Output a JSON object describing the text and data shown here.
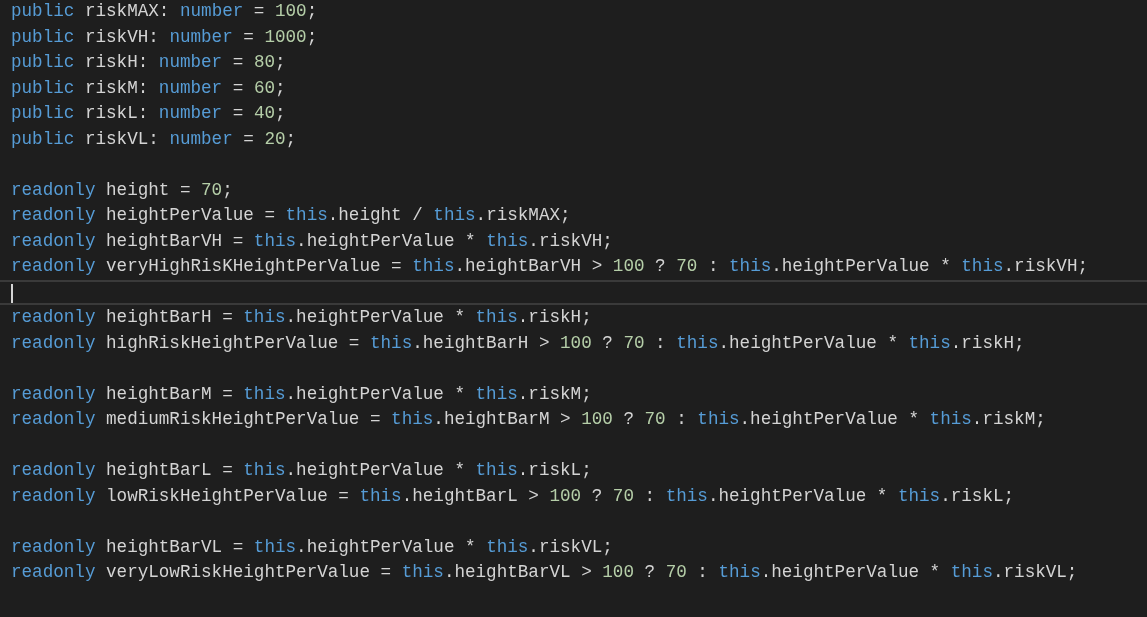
{
  "editor": {
    "lines": [
      {
        "kind": "code",
        "tokens": [
          {
            "kind": "keyword",
            "text": "public"
          },
          {
            "kind": "plain",
            "text": " riskMAX: "
          },
          {
            "kind": "type",
            "text": "number"
          },
          {
            "kind": "plain",
            "text": " = "
          },
          {
            "kind": "number",
            "text": "100"
          },
          {
            "kind": "plain",
            "text": ";"
          }
        ]
      },
      {
        "kind": "code",
        "tokens": [
          {
            "kind": "keyword",
            "text": "public"
          },
          {
            "kind": "plain",
            "text": " riskVH: "
          },
          {
            "kind": "type",
            "text": "number"
          },
          {
            "kind": "plain",
            "text": " = "
          },
          {
            "kind": "number",
            "text": "1000"
          },
          {
            "kind": "plain",
            "text": ";"
          }
        ]
      },
      {
        "kind": "code",
        "tokens": [
          {
            "kind": "keyword",
            "text": "public"
          },
          {
            "kind": "plain",
            "text": " riskH: "
          },
          {
            "kind": "type",
            "text": "number"
          },
          {
            "kind": "plain",
            "text": " = "
          },
          {
            "kind": "number",
            "text": "80"
          },
          {
            "kind": "plain",
            "text": ";"
          }
        ]
      },
      {
        "kind": "code",
        "tokens": [
          {
            "kind": "keyword",
            "text": "public"
          },
          {
            "kind": "plain",
            "text": " riskM: "
          },
          {
            "kind": "type",
            "text": "number"
          },
          {
            "kind": "plain",
            "text": " = "
          },
          {
            "kind": "number",
            "text": "60"
          },
          {
            "kind": "plain",
            "text": ";"
          }
        ]
      },
      {
        "kind": "code",
        "tokens": [
          {
            "kind": "keyword",
            "text": "public"
          },
          {
            "kind": "plain",
            "text": " riskL: "
          },
          {
            "kind": "type",
            "text": "number"
          },
          {
            "kind": "plain",
            "text": " = "
          },
          {
            "kind": "number",
            "text": "40"
          },
          {
            "kind": "plain",
            "text": ";"
          }
        ]
      },
      {
        "kind": "code",
        "tokens": [
          {
            "kind": "keyword",
            "text": "public"
          },
          {
            "kind": "plain",
            "text": " riskVL: "
          },
          {
            "kind": "type",
            "text": "number"
          },
          {
            "kind": "plain",
            "text": " = "
          },
          {
            "kind": "number",
            "text": "20"
          },
          {
            "kind": "plain",
            "text": ";"
          }
        ]
      },
      {
        "kind": "blank"
      },
      {
        "kind": "code",
        "tokens": [
          {
            "kind": "keyword",
            "text": "readonly"
          },
          {
            "kind": "plain",
            "text": " height = "
          },
          {
            "kind": "number",
            "text": "70"
          },
          {
            "kind": "plain",
            "text": ";"
          }
        ]
      },
      {
        "kind": "code",
        "tokens": [
          {
            "kind": "keyword",
            "text": "readonly"
          },
          {
            "kind": "plain",
            "text": " heightPerValue = "
          },
          {
            "kind": "keyword",
            "text": "this"
          },
          {
            "kind": "plain",
            "text": ".height / "
          },
          {
            "kind": "keyword",
            "text": "this"
          },
          {
            "kind": "plain",
            "text": ".riskMAX;"
          }
        ]
      },
      {
        "kind": "code",
        "tokens": [
          {
            "kind": "keyword",
            "text": "readonly"
          },
          {
            "kind": "plain",
            "text": " heightBarVH = "
          },
          {
            "kind": "keyword",
            "text": "this"
          },
          {
            "kind": "plain",
            "text": ".heightPerValue * "
          },
          {
            "kind": "keyword",
            "text": "this"
          },
          {
            "kind": "plain",
            "text": ".riskVH;"
          }
        ]
      },
      {
        "kind": "code",
        "tokens": [
          {
            "kind": "keyword",
            "text": "readonly"
          },
          {
            "kind": "plain",
            "text": " veryHighRisKHeightPerValue = "
          },
          {
            "kind": "keyword",
            "text": "this"
          },
          {
            "kind": "plain",
            "text": ".heightBarVH > "
          },
          {
            "kind": "number",
            "text": "100"
          },
          {
            "kind": "plain",
            "text": " ? "
          },
          {
            "kind": "number",
            "text": "70"
          },
          {
            "kind": "plain",
            "text": " : "
          },
          {
            "kind": "keyword",
            "text": "this"
          },
          {
            "kind": "plain",
            "text": ".heightPerValue * "
          },
          {
            "kind": "keyword",
            "text": "this"
          },
          {
            "kind": "plain",
            "text": ".riskVH;"
          }
        ]
      },
      {
        "kind": "cursor"
      },
      {
        "kind": "code",
        "tokens": [
          {
            "kind": "keyword",
            "text": "readonly"
          },
          {
            "kind": "plain",
            "text": " heightBarH = "
          },
          {
            "kind": "keyword",
            "text": "this"
          },
          {
            "kind": "plain",
            "text": ".heightPerValue * "
          },
          {
            "kind": "keyword",
            "text": "this"
          },
          {
            "kind": "plain",
            "text": ".riskH;"
          }
        ]
      },
      {
        "kind": "code",
        "tokens": [
          {
            "kind": "keyword",
            "text": "readonly"
          },
          {
            "kind": "plain",
            "text": " highRiskHeightPerValue = "
          },
          {
            "kind": "keyword",
            "text": "this"
          },
          {
            "kind": "plain",
            "text": ".heightBarH > "
          },
          {
            "kind": "number",
            "text": "100"
          },
          {
            "kind": "plain",
            "text": " ? "
          },
          {
            "kind": "number",
            "text": "70"
          },
          {
            "kind": "plain",
            "text": " : "
          },
          {
            "kind": "keyword",
            "text": "this"
          },
          {
            "kind": "plain",
            "text": ".heightPerValue * "
          },
          {
            "kind": "keyword",
            "text": "this"
          },
          {
            "kind": "plain",
            "text": ".riskH;"
          }
        ]
      },
      {
        "kind": "blank"
      },
      {
        "kind": "code",
        "tokens": [
          {
            "kind": "keyword",
            "text": "readonly"
          },
          {
            "kind": "plain",
            "text": " heightBarM = "
          },
          {
            "kind": "keyword",
            "text": "this"
          },
          {
            "kind": "plain",
            "text": ".heightPerValue * "
          },
          {
            "kind": "keyword",
            "text": "this"
          },
          {
            "kind": "plain",
            "text": ".riskM;"
          }
        ]
      },
      {
        "kind": "code",
        "tokens": [
          {
            "kind": "keyword",
            "text": "readonly"
          },
          {
            "kind": "plain",
            "text": " mediumRiskHeightPerValue = "
          },
          {
            "kind": "keyword",
            "text": "this"
          },
          {
            "kind": "plain",
            "text": ".heightBarM > "
          },
          {
            "kind": "number",
            "text": "100"
          },
          {
            "kind": "plain",
            "text": " ? "
          },
          {
            "kind": "number",
            "text": "70"
          },
          {
            "kind": "plain",
            "text": " : "
          },
          {
            "kind": "keyword",
            "text": "this"
          },
          {
            "kind": "plain",
            "text": ".heightPerValue * "
          },
          {
            "kind": "keyword",
            "text": "this"
          },
          {
            "kind": "plain",
            "text": ".riskM;"
          }
        ]
      },
      {
        "kind": "blank"
      },
      {
        "kind": "code",
        "tokens": [
          {
            "kind": "keyword",
            "text": "readonly"
          },
          {
            "kind": "plain",
            "text": " heightBarL = "
          },
          {
            "kind": "keyword",
            "text": "this"
          },
          {
            "kind": "plain",
            "text": ".heightPerValue * "
          },
          {
            "kind": "keyword",
            "text": "this"
          },
          {
            "kind": "plain",
            "text": ".riskL;"
          }
        ]
      },
      {
        "kind": "code",
        "tokens": [
          {
            "kind": "keyword",
            "text": "readonly"
          },
          {
            "kind": "plain",
            "text": " lowRiskHeightPerValue = "
          },
          {
            "kind": "keyword",
            "text": "this"
          },
          {
            "kind": "plain",
            "text": ".heightBarL > "
          },
          {
            "kind": "number",
            "text": "100"
          },
          {
            "kind": "plain",
            "text": " ? "
          },
          {
            "kind": "number",
            "text": "70"
          },
          {
            "kind": "plain",
            "text": " : "
          },
          {
            "kind": "keyword",
            "text": "this"
          },
          {
            "kind": "plain",
            "text": ".heightPerValue * "
          },
          {
            "kind": "keyword",
            "text": "this"
          },
          {
            "kind": "plain",
            "text": ".riskL;"
          }
        ]
      },
      {
        "kind": "blank"
      },
      {
        "kind": "code",
        "tokens": [
          {
            "kind": "keyword",
            "text": "readonly"
          },
          {
            "kind": "plain",
            "text": " heightBarVL = "
          },
          {
            "kind": "keyword",
            "text": "this"
          },
          {
            "kind": "plain",
            "text": ".heightPerValue * "
          },
          {
            "kind": "keyword",
            "text": "this"
          },
          {
            "kind": "plain",
            "text": ".riskVL;"
          }
        ]
      },
      {
        "kind": "code",
        "tokens": [
          {
            "kind": "keyword",
            "text": "readonly"
          },
          {
            "kind": "plain",
            "text": " veryLowRiskHeightPerValue = "
          },
          {
            "kind": "keyword",
            "text": "this"
          },
          {
            "kind": "plain",
            "text": ".heightBarVL > "
          },
          {
            "kind": "number",
            "text": "100"
          },
          {
            "kind": "plain",
            "text": " ? "
          },
          {
            "kind": "number",
            "text": "70"
          },
          {
            "kind": "plain",
            "text": " : "
          },
          {
            "kind": "keyword",
            "text": "this"
          },
          {
            "kind": "plain",
            "text": ".heightPerValue * "
          },
          {
            "kind": "keyword",
            "text": "this"
          },
          {
            "kind": "plain",
            "text": ".riskVL;"
          }
        ]
      }
    ]
  }
}
